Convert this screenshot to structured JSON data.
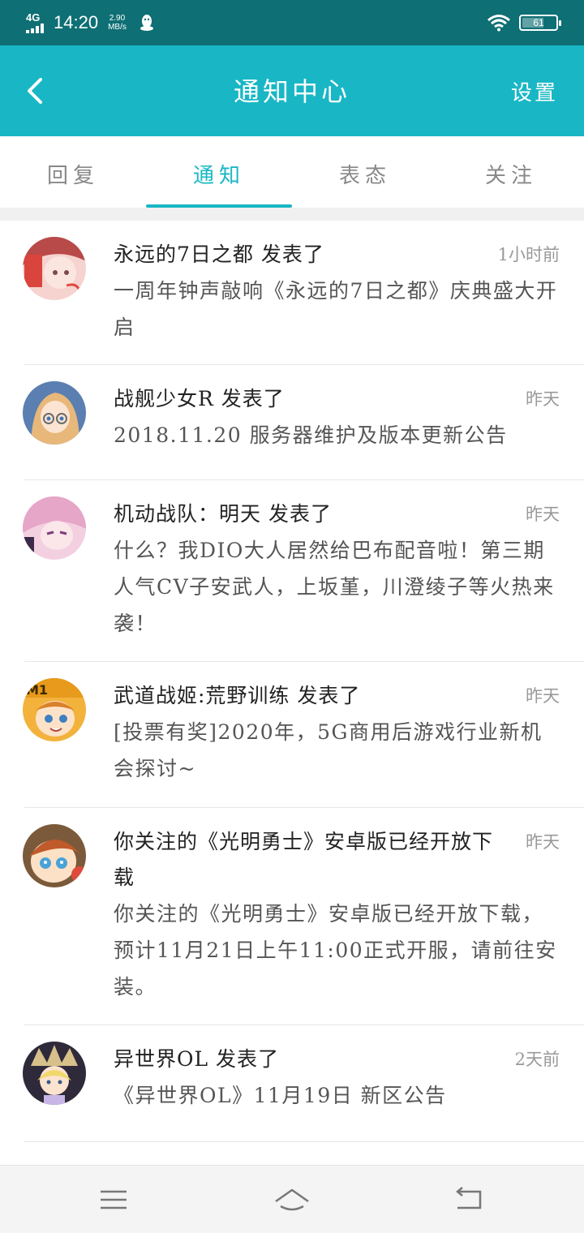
{
  "status_bar": {
    "network": "4G",
    "time": "14:20",
    "speed_value": "2.90",
    "speed_unit": "MB/s",
    "battery": "61"
  },
  "header": {
    "title": "通知中心",
    "settings_label": "设置"
  },
  "tabs": [
    {
      "label": "回复",
      "active": false
    },
    {
      "label": "通知",
      "active": true
    },
    {
      "label": "表态",
      "active": false
    },
    {
      "label": "关注",
      "active": false
    }
  ],
  "notifications": [
    {
      "title": "永远的7日之都 发表了",
      "time": "1小时前",
      "body": "一周年钟声敲响《永远的7日之都》庆典盛大开启",
      "avatar_icon": "game-avatar-7days"
    },
    {
      "title": "战舰少女R 发表了",
      "time": "昨天",
      "body": "2018.11.20 服务器维护及版本更新公告",
      "avatar_icon": "game-avatar-warship-girls"
    },
    {
      "title": "机动战队：明天 发表了",
      "time": "昨天",
      "body": "什么？我DIO大人居然给巴布配音啦！第三期人气CV子安武人，上坂堇，川澄绫子等火热来袭！",
      "avatar_icon": "game-avatar-mobile-squad"
    },
    {
      "title": "武道战姬:荒野训练 发表了",
      "time": "昨天",
      "body": "[投票有奖]2020年，5G商用后游戏行业新机会探讨~",
      "avatar_icon": "game-avatar-martial-princess"
    },
    {
      "title": "你关注的《光明勇士》安卓版已经开放下载",
      "time": "昨天",
      "body": "你关注的《光明勇士》安卓版已经开放下载，预计11月21日上午11:00正式开服，请前往安装。",
      "avatar_icon": "game-avatar-light-hero"
    },
    {
      "title": "异世界OL 发表了",
      "time": "2天前",
      "body": "《异世界OL》11月19日 新区公告",
      "avatar_icon": "game-avatar-isekai-ol"
    }
  ],
  "colors": {
    "status_bar": "#0e6f74",
    "header": "#19b7c5",
    "accent": "#19b7c5"
  }
}
